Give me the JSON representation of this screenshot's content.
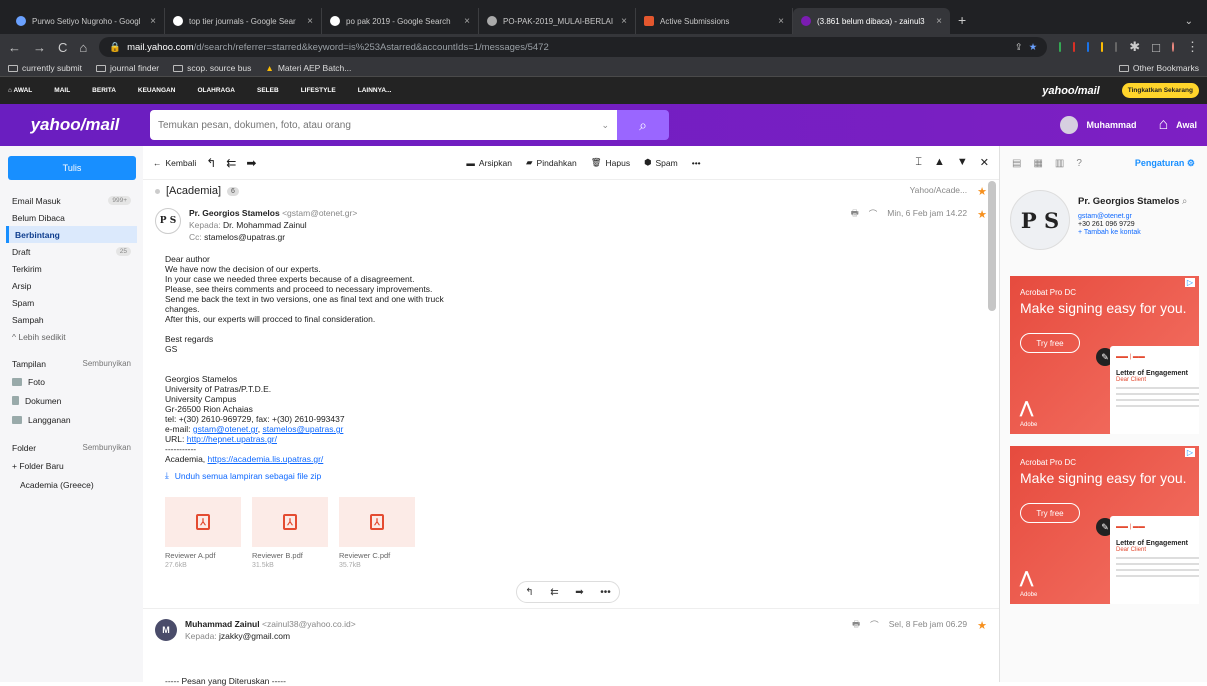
{
  "browser": {
    "tabs": [
      {
        "title": "Purwo Setiyo Nugroho - Googl",
        "color": "#6aa1ff"
      },
      {
        "title": "top tier journals - Google Sear",
        "color": "#ffffff"
      },
      {
        "title": "po pak 2019 - Google Search",
        "color": "#ffffff"
      },
      {
        "title": "PO-PAK-2019_MULAI-BERLAI",
        "color": "#aaaaaa"
      },
      {
        "title": "Active Submissions",
        "color": "#e4572e"
      },
      {
        "title": "(3.861 belum dibaca) - zainul3",
        "color": "#7b1cb2"
      }
    ],
    "url_domain": "mail.yahoo.com",
    "url_path": "/d/search/referrer=starred&keyword=is%253Astarred&accountIds=1/messages/5472",
    "bookmarks": [
      "currently submit",
      "journal finder",
      "scop. source bus",
      "Materi AEP Batch..."
    ],
    "other_bookmarks": "Other Bookmarks"
  },
  "ynav": {
    "items": [
      "AWAL",
      "MAIL",
      "BERITA",
      "KEUANGAN",
      "OLAHRAGA",
      "SELEB",
      "LIFESTYLE",
      "LAINNYA..."
    ],
    "logo": "yahoo/mail",
    "upgrade": "Tingkatkan Sekarang"
  },
  "header": {
    "logo": "yahoo/mail",
    "search_placeholder": "Temukan pesan, dokumen, foto, atau orang",
    "user": "Muhammad",
    "home": "Awal"
  },
  "sidebar": {
    "compose": "Tulis",
    "folders": [
      {
        "label": "Email Masuk",
        "count": "999+"
      },
      {
        "label": "Belum Dibaca",
        "count": ""
      },
      {
        "label": "Berbintang",
        "count": ""
      },
      {
        "label": "Draft",
        "count": "25"
      },
      {
        "label": "Terkirim",
        "count": ""
      },
      {
        "label": "Arsip",
        "count": ""
      },
      {
        "label": "Spam",
        "count": ""
      },
      {
        "label": "Sampah",
        "count": ""
      },
      {
        "label": "^ Lebih sedikit",
        "count": ""
      }
    ],
    "views_head": "Tampilan",
    "views_hide": "Sembunyikan",
    "views": [
      "Foto",
      "Dokumen",
      "Langganan"
    ],
    "folder_head": "Folder",
    "folder_hide": "Sembunyikan",
    "new_folder": "+ Folder Baru",
    "custom_folder": "Academia (Greece)"
  },
  "toolbar": {
    "back": "Kembali",
    "archive": "Arsipkan",
    "move": "Pindahkan",
    "delete": "Hapus",
    "spam": "Spam",
    "more": "•••"
  },
  "thread": {
    "subject": "[Academia]",
    "count": "6",
    "folder": "Yahoo/Acade..."
  },
  "message1": {
    "logo": "P S",
    "from_name": "Pr. Georgios Stamelos",
    "from_email": "<gstam@otenet.gr>",
    "to_label": "Kepada:",
    "to": "Dr. Mohammad Zainul",
    "cc_label": "Cc:",
    "cc": "stamelos@upatras.gr",
    "date": "Min, 6 Feb jam 14.22",
    "body": "Dear author\nWe have now the decision of our experts.\nIn your case we needed three experts because of a disagreement.\nPlease, see theirs comments and proceed to necessary improvements.\nSend me back the text in two versions, one as final text and one with truck\nchanges.\nAfter this, our experts will procced to final consideration.\n\nBest regards\nGS\n\n\nGeorgios Stamelos\nUniversity of Patras/P.T.D.E.\nUniversity Campus\nGr-26500 Rion Achaias\ntel: +(30) 2610-969729, fax: +(30) 2610-993437",
    "email_line_prefix": "e-mail: ",
    "email_link1": "gstam@otenet.gr",
    "email_link2": "stamelos@upatras.gr",
    "url_prefix": "URL: ",
    "url_link": "http://hepnet.upatras.gr/",
    "sep": "-----------",
    "academia_prefix": "Academia, ",
    "academia_link": "https://academia.lis.upatras.gr/",
    "download_all": "Unduh semua lampiran sebagai file zip",
    "attachments": [
      {
        "name": "Reviewer A.pdf",
        "size": "27.6kB"
      },
      {
        "name": "Reviewer B.pdf",
        "size": "31.5kB"
      },
      {
        "name": "Reviewer C.pdf",
        "size": "35.7kB"
      }
    ]
  },
  "message2": {
    "from_name": "Muhammad Zainul",
    "from_email": "<zainul38@yahoo.co.id>",
    "to_label": "Kepada:",
    "to": "jzakky@gmail.com",
    "date": "Sel, 8 Feb jam 06.29",
    "forwarded": "----- Pesan yang Diteruskan -----"
  },
  "rightpane": {
    "settings": "Pengaturan",
    "contact_name": "Pr. Georgios Stamelos",
    "contact_email": "gstam@otenet.gr",
    "contact_phone": "+30 261 096 9729",
    "add_contact": "+ Tambah ke kontak",
    "ad": {
      "product": "Acrobat Pro DC",
      "headline": "Make signing easy for you.",
      "cta": "Try free",
      "doc_title": "Letter of Engagement",
      "doc_sub": "Dear Client",
      "brand": "Adobe"
    }
  }
}
